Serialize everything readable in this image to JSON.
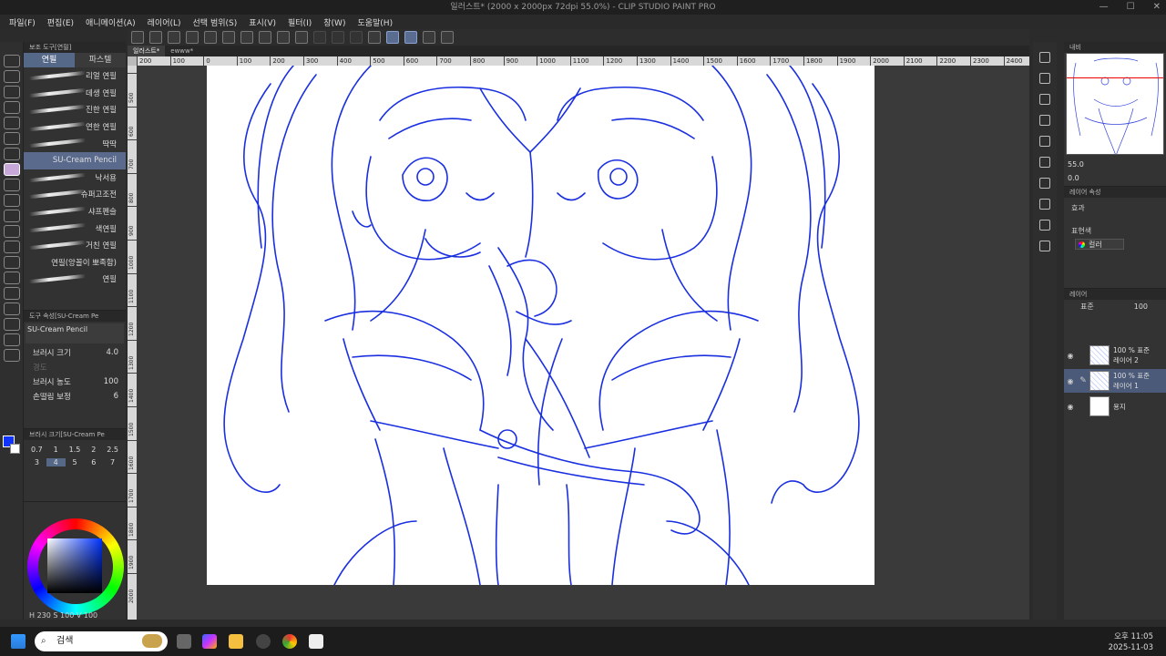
{
  "window": {
    "title": "일러스트* (2000 x 2000px 72dpi 55.0%)  - CLIP STUDIO PAINT PRO"
  },
  "menu": [
    "파일(F)",
    "편집(E)",
    "애니메이션(A)",
    "레이어(L)",
    "선택 범위(S)",
    "표시(V)",
    "필터(I)",
    "창(W)",
    "도움말(H)"
  ],
  "document_tabs": [
    "일러스트*",
    "ewww*"
  ],
  "ruler": {
    "h_marks": [
      "200",
      "100",
      "0",
      "100",
      "200",
      "300",
      "400",
      "500",
      "600",
      "700",
      "800",
      "900",
      "1000",
      "1100",
      "1200",
      "1300",
      "1400",
      "1500",
      "1600",
      "1700",
      "1800",
      "1900",
      "2000",
      "2100",
      "2200",
      "2300",
      "2400"
    ],
    "v_marks": [
      "500",
      "600",
      "700",
      "800",
      "900",
      "1000",
      "1100",
      "1200",
      "1300",
      "1400",
      "1500",
      "1600",
      "1700",
      "1800",
      "1900",
      "2000"
    ]
  },
  "subtool": {
    "header": "보조 도구[연필]",
    "tabs": [
      "연필",
      "파스텔"
    ],
    "brushes": [
      "리얼 연필",
      "데생 연필",
      "진한 연필",
      "연한 연필",
      "딱딱",
      "SU-Cream Pencil",
      "낙서용",
      "슈퍼고조전",
      "샤프펜슬",
      "색연필",
      "거친 연필",
      "연필(앙꼴이 뽀족함)",
      "연필"
    ],
    "selected_index": 5
  },
  "tool_property": {
    "header": "도구 속성[SU-Cream Pe",
    "preview_name": "SU-Cream Pencil",
    "brush_size_label": "브러시 크기",
    "brush_size_value": "4.0",
    "hardness_label": "경도",
    "density_label": "브러시 농도",
    "density_value": "100",
    "stabilization_label": "손떨림 보정",
    "stabilization_value": "6"
  },
  "brush_size_panel": {
    "header": "브러시 크기[SU-Cream Pe",
    "sizes": [
      "0.7",
      "1",
      "1.5",
      "2",
      "2.5",
      "3",
      "4",
      "5",
      "6",
      "7"
    ],
    "selected": "4"
  },
  "color": {
    "foreground": "#1133ff",
    "background": "#ffffff",
    "h": "230",
    "s": "100",
    "v": "100"
  },
  "navigator": {
    "header": "내비",
    "zoom": "55.0",
    "rotation": "0.0"
  },
  "layer_property": {
    "header": "레이어 속성",
    "effect_label": "효과",
    "expression_label": "표현색",
    "expression_value": "컬러"
  },
  "layers_panel": {
    "header": "레이어",
    "blend_mode": "표준",
    "opacity": "100",
    "layers": [
      {
        "line1": "100 % 표준",
        "line2": "레이어 2",
        "type": "sketch",
        "active": false
      },
      {
        "line1": "100 % 표준",
        "line2": "레이어 1",
        "type": "sketch",
        "active": true
      },
      {
        "line1": "",
        "line2": "용지",
        "type": "paper",
        "active": false
      }
    ]
  },
  "taskbar": {
    "search_placeholder": "검색",
    "time": "오후 11:05",
    "date": "2025-11-03"
  }
}
